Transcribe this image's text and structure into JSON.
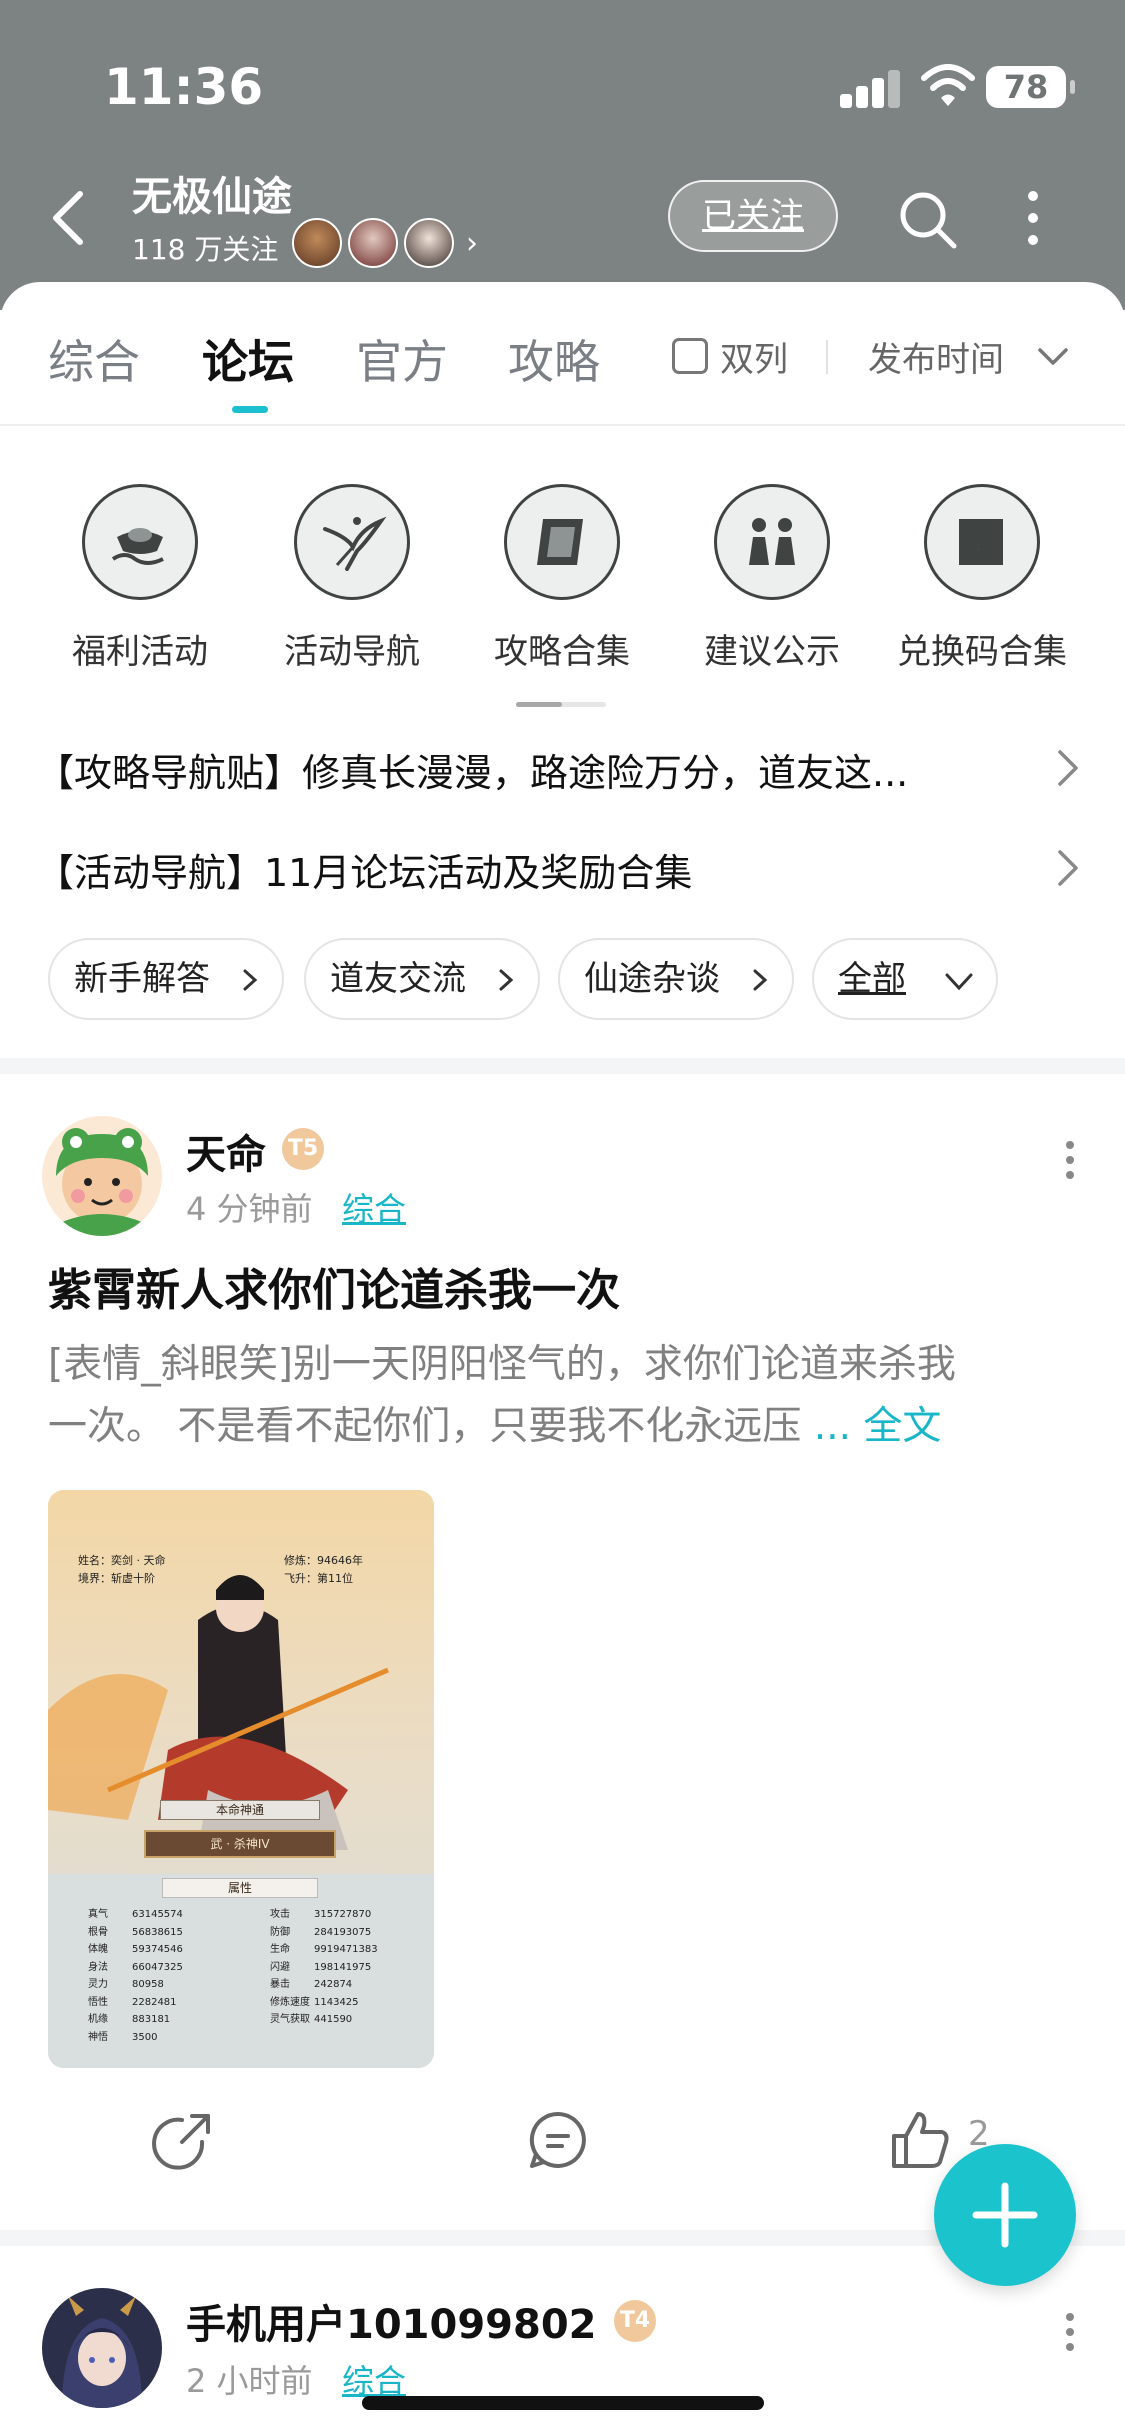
{
  "status_bar": {
    "time": "11:36",
    "battery": "78"
  },
  "header": {
    "title": "无极仙途",
    "followers": "118 万关注",
    "followed_label": "已关注"
  },
  "tabs": [
    {
      "label": "综合"
    },
    {
      "label": "论坛"
    },
    {
      "label": "官方"
    },
    {
      "label": "攻略"
    }
  ],
  "filters": {
    "dual_column": "双列",
    "sort": "发布时间"
  },
  "shortcuts": [
    {
      "label": "福利活动",
      "icon": "ingot-cloud-icon"
    },
    {
      "label": "活动导航",
      "icon": "crane-icon"
    },
    {
      "label": "攻略合集",
      "icon": "scroll-icon"
    },
    {
      "label": "建议公示",
      "icon": "chess-pieces-icon"
    },
    {
      "label": "兑换码合集",
      "icon": "moon-scroll-icon"
    }
  ],
  "pinned": [
    {
      "text": "【攻略导航贴】修真长漫漫，路途险万分，道友这..."
    },
    {
      "text": "【活动导航】11月论坛活动及奖励合集"
    }
  ],
  "chips": [
    {
      "label": "新手解答"
    },
    {
      "label": "道友交流"
    },
    {
      "label": "仙途杂谈"
    },
    {
      "label": "全部"
    }
  ],
  "posts": [
    {
      "user": "天命",
      "level": "T5",
      "time": "4 分钟前",
      "category": "综合",
      "title": "紫霄新人求你们论道杀我一次",
      "body_line1": "[表情_斜眼笑]别一天阴阳怪气的，求你们论道来杀我",
      "body_line2": "一次。 不是看不起你们，只要我不化永远压",
      "fulltext": "... 全文",
      "likes": "2",
      "image": {
        "name_label": "姓名：",
        "name_value": "奕剑 · 天命",
        "realm_label": "境界：",
        "realm_value": "斩虚十阶",
        "cultivation_label": "修炼：",
        "cultivation_value": "94646年",
        "ascension_label": "飞升：",
        "ascension_value": "第11位",
        "divine_title": "本命神通",
        "divine_value": "武 · 杀神IV",
        "attr_title": "属性",
        "attributes_left": [
          {
            "k": "真气",
            "v": "63145574"
          },
          {
            "k": "根骨",
            "v": "56838615"
          },
          {
            "k": "体魄",
            "v": "59374546"
          },
          {
            "k": "身法",
            "v": "66047325"
          },
          {
            "k": "灵力",
            "v": "80958"
          },
          {
            "k": "悟性",
            "v": "2282481"
          },
          {
            "k": "机缘",
            "v": "883181"
          },
          {
            "k": "神悟",
            "v": "3500"
          }
        ],
        "attributes_right": [
          {
            "k": "攻击",
            "v": "315727870"
          },
          {
            "k": "防御",
            "v": "284193075"
          },
          {
            "k": "生命",
            "v": "9919471383"
          },
          {
            "k": "闪避",
            "v": "198141975"
          },
          {
            "k": "暴击",
            "v": "242874"
          },
          {
            "k": "修炼速度",
            "v": "1143425"
          },
          {
            "k": "灵气获取",
            "v": "441590"
          }
        ]
      }
    },
    {
      "user": "手机用户101099802",
      "level": "T4",
      "time": "2 小时前",
      "category": "综合"
    }
  ],
  "colors": {
    "accent": "#1bc3cc",
    "header_bg": "#7d8382"
  }
}
